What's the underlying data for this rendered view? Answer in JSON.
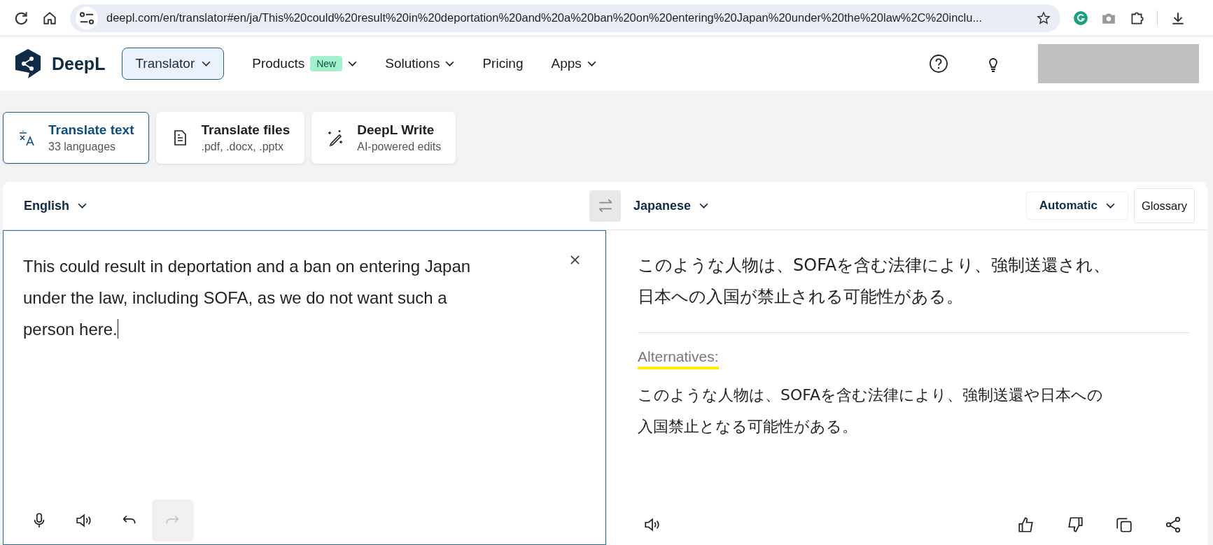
{
  "browser": {
    "url": "deepl.com/en/translator#en/ja/This%20could%20result%20in%20deportation%20and%20a%20ban%20on%20entering%20Japan%20under%20the%20law%2C%20inclu..."
  },
  "header": {
    "logo_text": "DeepL",
    "product_button": "Translator",
    "nav": [
      {
        "label": "Products",
        "badge": "New",
        "has_menu": true
      },
      {
        "label": "Solutions",
        "has_menu": true
      },
      {
        "label": "Pricing",
        "has_menu": false
      },
      {
        "label": "Apps",
        "has_menu": true
      }
    ]
  },
  "tabs": [
    {
      "kind": "text",
      "title": "Translate text",
      "subtitle": "33 languages",
      "selected": true
    },
    {
      "kind": "files",
      "title": "Translate files",
      "subtitle": ".pdf, .docx, .pptx",
      "selected": false
    },
    {
      "kind": "write",
      "title": "DeepL Write",
      "subtitle": "AI-powered edits",
      "selected": false
    }
  ],
  "translator": {
    "source_language": "English",
    "target_language": "Japanese",
    "formality": "Automatic",
    "glossary": "Glossary",
    "source_lines": [
      "This could result in deportation and a ban on entering Japan",
      "under the law, including SOFA, as we do not want such a",
      "person here."
    ],
    "translation_lines": [
      "このような人物は、SOFAを含む法律により、強制送還され、",
      "日本への入国が禁止される可能性がある。"
    ],
    "alternatives_label": "Alternatives:",
    "alternative_lines": [
      "このような人物は、SOFAを含む法律により、強制送還や日本への",
      "入国禁止となる可能性がある。"
    ],
    "redo_disabled": true
  }
}
